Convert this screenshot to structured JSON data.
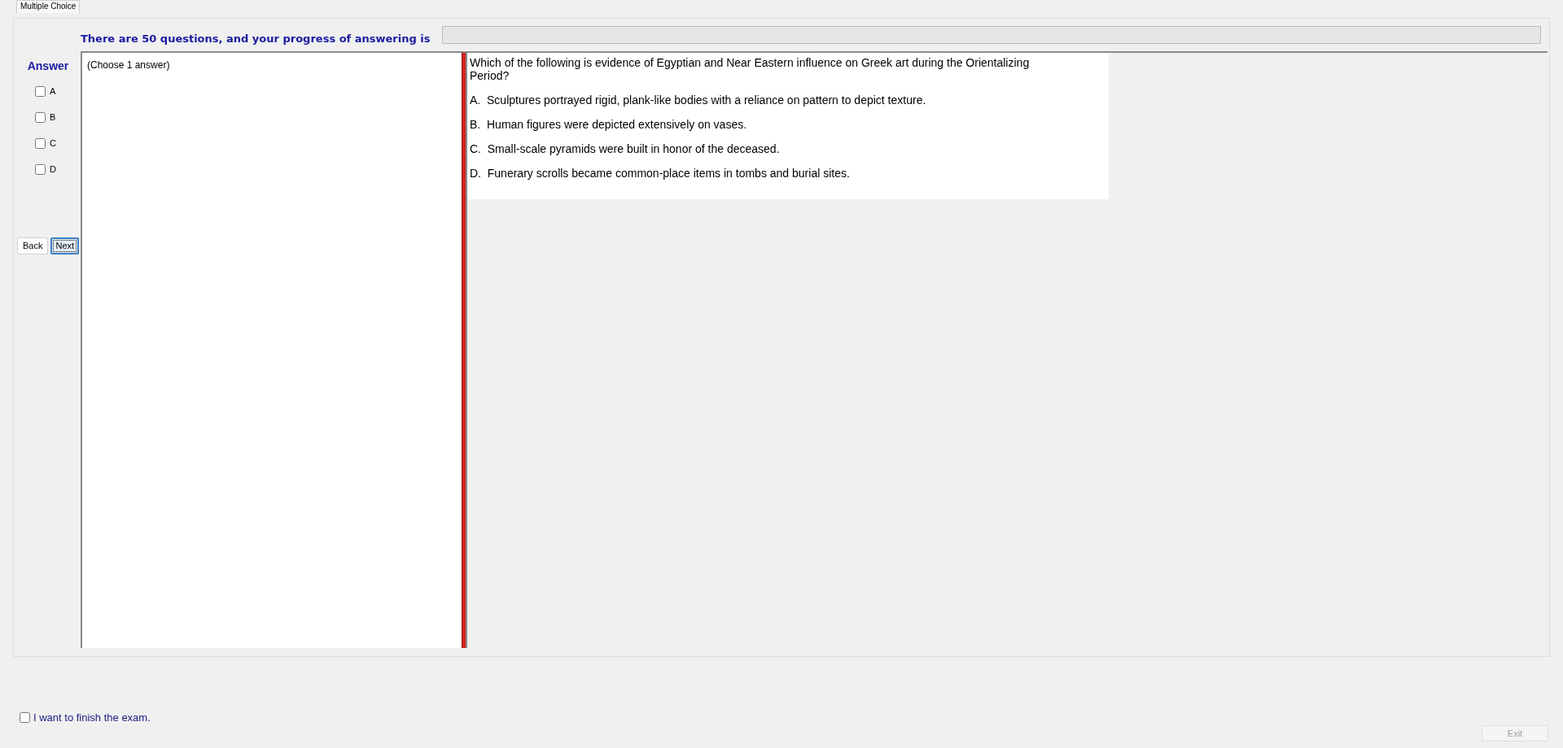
{
  "tabs": [
    {
      "label": "Multiple Choice",
      "selected": true
    }
  ],
  "header": {
    "text": "There are 50 questions, and your progress of answering is",
    "progress": {
      "level": 0
    }
  },
  "answer_panel": {
    "title": "Answer",
    "options": [
      {
        "label": "A",
        "checked": false
      },
      {
        "label": "B",
        "checked": false
      },
      {
        "label": "C",
        "checked": false
      },
      {
        "label": "D",
        "checked": false
      }
    ],
    "buttons": [
      {
        "label": "Back",
        "focused": false
      },
      {
        "label": "Next",
        "focused": true
      }
    ]
  },
  "instruction": "(Choose 1 answer)",
  "question": {
    "text": "Which of the following is evidence of Egyptian and Near Eastern influence on Greek art during the Orientalizing Period?",
    "choices": [
      "A.  Sculptures portrayed rigid, plank-like bodies with a reliance on pattern to depict texture.",
      "B.  Human figures were depicted extensively on vases.",
      "C.  Small-scale pyramids were built in honor of the deceased.",
      "D.  Funerary scrolls became common-place items in tombs and burial sites."
    ]
  },
  "finish": {
    "label": "I want to finish the exam.",
    "checked": false
  },
  "exit_button": {
    "label": "Exit",
    "disabled": true
  }
}
